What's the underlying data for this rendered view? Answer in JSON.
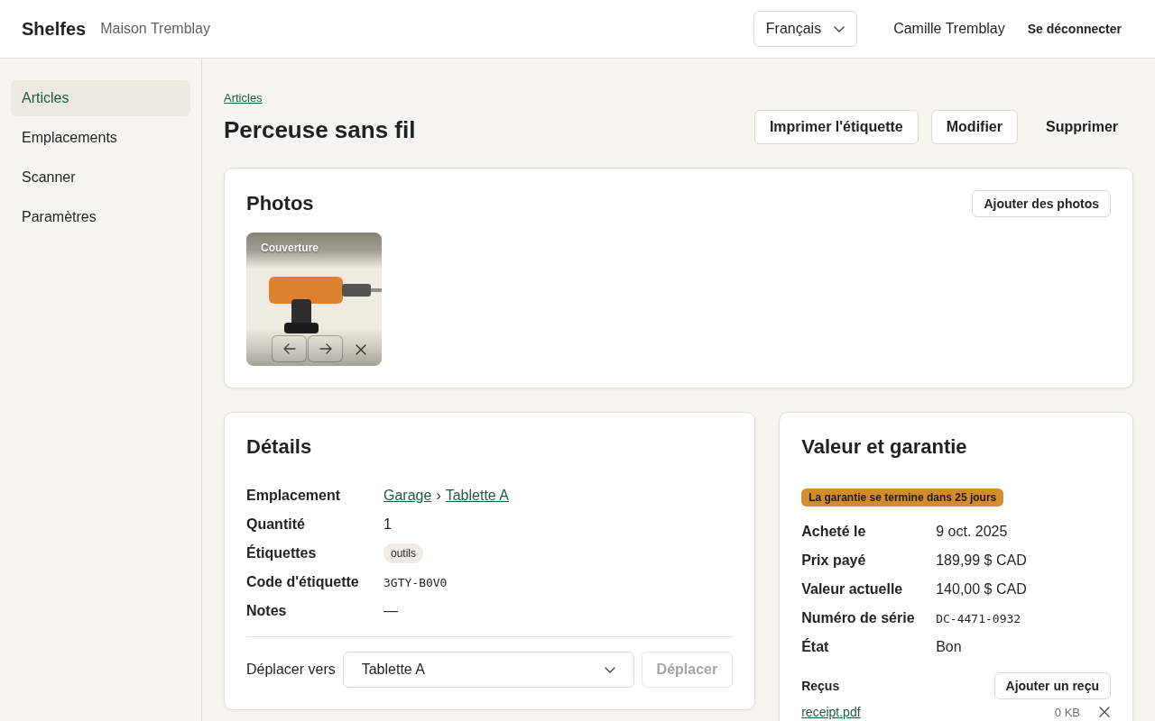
{
  "header": {
    "brand": "Shelfes",
    "household": "Maison Tremblay",
    "language": "Français",
    "user": "Camille Tremblay",
    "logout": "Se déconnecter"
  },
  "sidebar": {
    "items": [
      {
        "label": "Articles",
        "selected": true
      },
      {
        "label": "Emplacements",
        "selected": false
      },
      {
        "label": "Scanner",
        "selected": false
      },
      {
        "label": "Paramètres",
        "selected": false
      }
    ]
  },
  "page": {
    "breadcrumb": "Articles",
    "title": "Perceuse sans fil",
    "actions": [
      {
        "label": "Imprimer l'étiquette",
        "kind": "outline"
      },
      {
        "label": "Modifier",
        "kind": "outline"
      },
      {
        "label": "Supprimer",
        "kind": "plain"
      }
    ]
  },
  "photos": {
    "title": "Photos",
    "add_button": "Ajouter des photos",
    "items": [
      {
        "caption": "Couverture"
      }
    ]
  },
  "details": {
    "title": "Détails",
    "fields": [
      {
        "label": "Emplacement",
        "kind": "path",
        "path": [
          "Garage",
          "Tablette A"
        ],
        "separator": "›"
      },
      {
        "label": "Quantité",
        "kind": "text",
        "value": "1"
      },
      {
        "label": "Étiquettes",
        "kind": "tags",
        "tags": [
          "outils"
        ]
      },
      {
        "label": "Code d'étiquette",
        "kind": "code",
        "value": "3GTY-B0V0"
      },
      {
        "label": "Notes",
        "kind": "text",
        "value": "—"
      }
    ],
    "move": {
      "label": "Déplacer vers",
      "value": "Tablette A",
      "button": "Déplacer",
      "disabled": true
    }
  },
  "value": {
    "title": "Valeur et garantie",
    "notice": "La garantie se termine dans 25 jours",
    "fields": [
      {
        "label": "Acheté le",
        "kind": "text",
        "value": "9 oct. 2025"
      },
      {
        "label": "Prix payé",
        "kind": "text",
        "value": "189,99 $ CAD"
      },
      {
        "label": "Valeur actuelle",
        "kind": "text",
        "value": "140,00 $ CAD"
      },
      {
        "label": "Numéro de série",
        "kind": "code",
        "value": "DC-4471-0932"
      },
      {
        "label": "État",
        "kind": "text",
        "value": "Bon"
      }
    ],
    "receipts": {
      "label": "Reçus",
      "add_button": "Ajouter un reçu",
      "files": [
        {
          "name": "receipt.pdf",
          "size": "0 KB"
        }
      ]
    }
  }
}
